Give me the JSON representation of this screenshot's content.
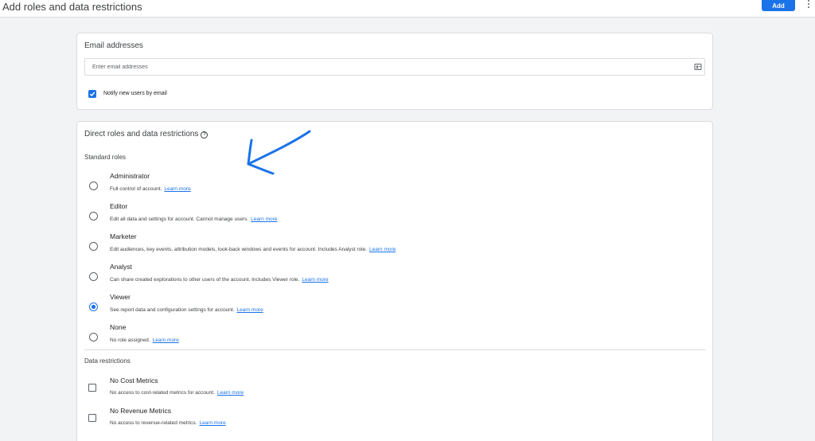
{
  "header": {
    "title": "Add roles and data restrictions",
    "add_label": "Add"
  },
  "email": {
    "title": "Email addresses",
    "placeholder": "Enter email addresses",
    "notify_label": "Notify new users by email",
    "notify_checked": true
  },
  "roles": {
    "title": "Direct roles and data restrictions",
    "standard_label": "Standard roles",
    "learn_more": "Learn more",
    "items": [
      {
        "name": "Administrator",
        "desc": "Full control of account.",
        "selected": false
      },
      {
        "name": "Editor",
        "desc": "Edit all data and settings for account. Cannot manage users.",
        "selected": false
      },
      {
        "name": "Marketer",
        "desc": "Edit audiences, key events, attribution models, look-back windows and events for account. Includes Analyst role.",
        "selected": false
      },
      {
        "name": "Analyst",
        "desc": "Can share created explorations to other users of the account. Includes Viewer role.",
        "selected": false
      },
      {
        "name": "Viewer",
        "desc": "See report data and configuration settings for account.",
        "selected": true
      },
      {
        "name": "None",
        "desc": "No role assigned.",
        "selected": false
      }
    ]
  },
  "restrictions": {
    "title": "Data restrictions",
    "items": [
      {
        "name": "No Cost Metrics",
        "desc": "No access to cost-related metrics for account.",
        "checked": false
      },
      {
        "name": "No Revenue Metrics",
        "desc": "No access to revenue-related metrics.",
        "checked": false
      }
    ]
  },
  "colors": {
    "accent": "#1a73e8",
    "annotation": "#1a73e8"
  },
  "icons": [
    "more-vert-icon",
    "contacts-icon",
    "check-icon",
    "help-icon",
    "annotation-arrow"
  ]
}
